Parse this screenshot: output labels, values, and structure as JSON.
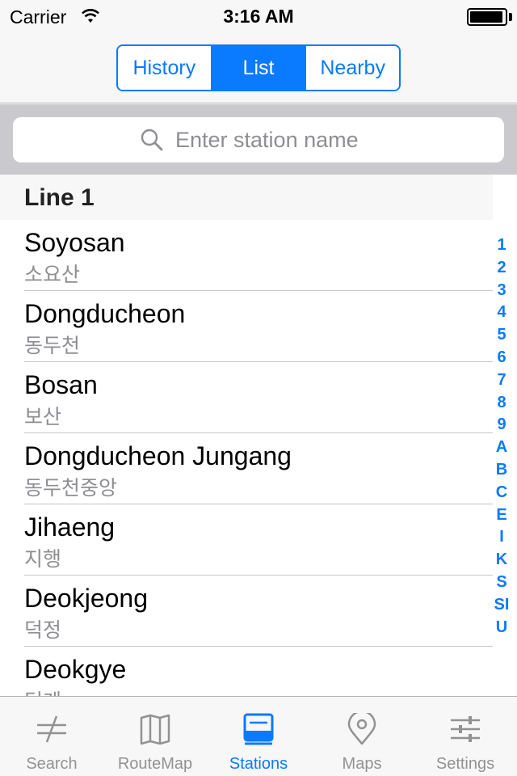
{
  "status_bar": {
    "carrier": "Carrier",
    "time": "3:16 AM"
  },
  "segmented_control": {
    "segments": [
      {
        "label": "History",
        "selected": false
      },
      {
        "label": "List",
        "selected": true
      },
      {
        "label": "Nearby",
        "selected": false
      }
    ]
  },
  "search": {
    "placeholder": "Enter station name",
    "value": ""
  },
  "list": {
    "section_title": "Line 1",
    "rows": [
      {
        "name": "Soyosan",
        "korean": "소요산"
      },
      {
        "name": "Dongducheon",
        "korean": "동두천"
      },
      {
        "name": "Bosan",
        "korean": "보산"
      },
      {
        "name": "Dongducheon Jungang",
        "korean": "동두천중앙"
      },
      {
        "name": "Jihaeng",
        "korean": "지행"
      },
      {
        "name": "Deokjeong",
        "korean": "덕정"
      },
      {
        "name": "Deokgye",
        "korean": "덕계"
      }
    ]
  },
  "section_index": [
    "1",
    "2",
    "3",
    "4",
    "5",
    "6",
    "7",
    "8",
    "9",
    "A",
    "B",
    "C",
    "E",
    "I",
    "K",
    "S",
    "SI",
    "U"
  ],
  "tab_bar": {
    "tabs": [
      {
        "label": "Search",
        "icon": "search-arrows-icon",
        "active": false
      },
      {
        "label": "RouteMap",
        "icon": "map-book-icon",
        "active": false
      },
      {
        "label": "Stations",
        "icon": "station-list-icon",
        "active": true
      },
      {
        "label": "Maps",
        "icon": "location-pin-icon",
        "active": false
      },
      {
        "label": "Settings",
        "icon": "sliders-icon",
        "active": false
      }
    ]
  },
  "colors": {
    "accent": "#0a7aff",
    "inactive_tab": "#929292",
    "subtitle_gray": "#8e8e93",
    "search_bar_bg": "#c9c9ce"
  }
}
